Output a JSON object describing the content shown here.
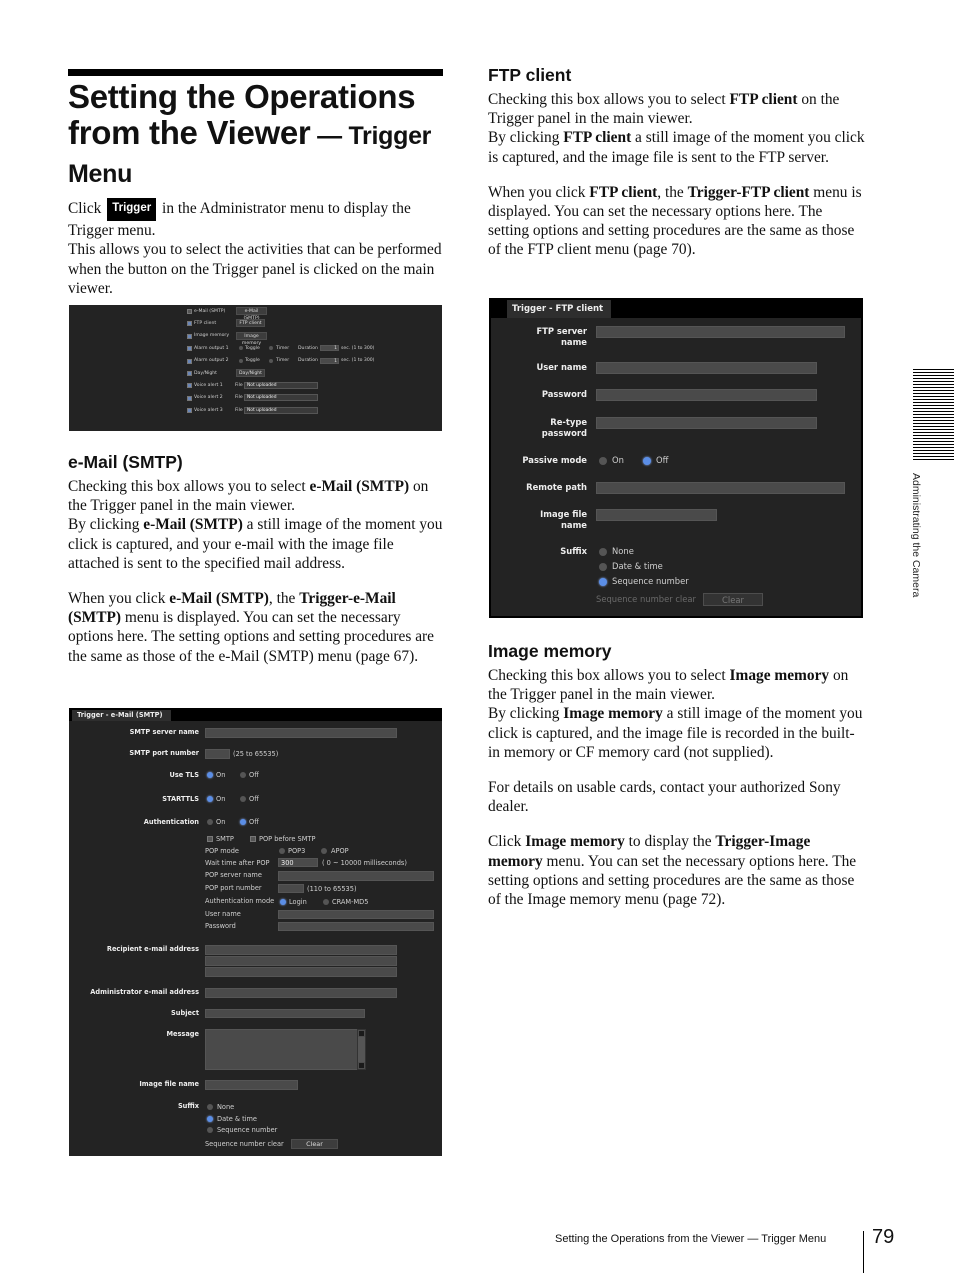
{
  "page": {
    "title_main": "Setting the Operations from the Viewer",
    "title_sub_dash": " — Trigger",
    "title_sub2": "Menu",
    "footer": "Setting the Operations from the Viewer — Trigger Menu",
    "page_number": "79",
    "side_tab": "Administrating the Camera"
  },
  "intro": {
    "click": "Click",
    "chip": "Trigger",
    "rest1": " in the Administrator menu to display the Trigger menu.",
    "para2": "This allows you to select the activities that can be performed when the button on the Trigger panel is clicked on the main viewer."
  },
  "overview_panel": {
    "rows": [
      {
        "label": "e-Mail (SMTP)",
        "checked": false,
        "button": "e-Mail (SMTP)"
      },
      {
        "label": "FTP client",
        "checked": true,
        "button": "FTP client"
      },
      {
        "label": "Image memory",
        "checked": true,
        "button": "Image memory"
      },
      {
        "label": "Alarm output 1",
        "checked": true,
        "opt1": "Toggle",
        "opt2": "Timer",
        "duration_label": "Duration",
        "duration_value": "1",
        "range": "sec. (1 to 300)"
      },
      {
        "label": "Alarm output 2",
        "checked": true,
        "opt1": "Toggle",
        "opt2": "Timer",
        "duration_label": "Duration",
        "duration_value": "1",
        "range": "sec. (1 to 300)"
      },
      {
        "label": "Day/Night",
        "checked": true,
        "button": "Day/Night"
      },
      {
        "label": "Voice alert 1",
        "checked": true,
        "file_label": "File",
        "file_value": "Not uploaded"
      },
      {
        "label": "Voice alert 2",
        "checked": true,
        "file_label": "File",
        "file_value": "Not uploaded"
      },
      {
        "label": "Voice alert 3",
        "checked": true,
        "file_label": "File",
        "file_value": "Not uploaded"
      }
    ]
  },
  "email": {
    "heading": "e-Mail (SMTP)",
    "p1_a": "Checking this box allows you to select ",
    "p1_b": "e-Mail (SMTP)",
    "p1_c": " on the Trigger panel in the main viewer.",
    "p2_a": "By clicking ",
    "p2_b": "e-Mail (SMTP)",
    "p2_c": " a still image of the moment you click is captured, and your e-mail with the image file attached is sent to the specified mail address.",
    "p3_a": "When you click ",
    "p3_b": "e-Mail (SMTP)",
    "p3_c": ", the ",
    "p3_d": "Trigger-e-Mail (SMTP)",
    "p3_e": " menu is displayed. You can set the necessary options here. The setting options and setting procedures are the same as those of the e-Mail (SMTP) menu (page 67)."
  },
  "email_panel": {
    "tab": "Trigger - e-Mail (SMTP)",
    "smtp_server_name": "SMTP server name",
    "smtp_port_number": "SMTP port number",
    "smtp_port_range": "(25 to 65535)",
    "use_tls": "Use TLS",
    "starttls": "STARTTLS",
    "authentication": "Authentication",
    "on": "On",
    "off": "Off",
    "use_tls_value": "On",
    "starttls_value": "On",
    "authentication_value": "Off",
    "smtp_chk": "SMTP",
    "pop_before_smtp_chk": "POP before SMTP",
    "pop_mode": "POP mode",
    "pop3": "POP3",
    "apop": "APOP",
    "wait_time": "Wait time after POP",
    "wait_time_value": "300",
    "wait_time_range": "( 0 ~ 10000 milliseconds)",
    "pop_server_name": "POP server name",
    "pop_port_number": "POP port number",
    "pop_port_range": "(110 to 65535)",
    "auth_mode": "Authentication mode",
    "login": "Login",
    "cram": "CRAM-MD5",
    "auth_mode_value": "Login",
    "user_name": "User name",
    "password": "Password",
    "recipient": "Recipient e-mail address",
    "administrator": "Administrator e-mail address",
    "subject": "Subject",
    "message": "Message",
    "image_file_name": "Image file name",
    "suffix": "Suffix",
    "suffix_none": "None",
    "suffix_date": "Date & time",
    "suffix_seq": "Sequence number",
    "suffix_value": "Date & time",
    "seq_clear": "Sequence number clear",
    "clear": "Clear"
  },
  "ftp": {
    "heading": "FTP client",
    "p1_a": "Checking this box allows you to select ",
    "p1_b": "FTP client",
    "p1_c": " on the Trigger panel in the main viewer.",
    "p2_a": "By clicking ",
    "p2_b": "FTP client",
    "p2_c": " a still image of the moment you click is captured, and the image file is sent to the FTP server.",
    "p3_a": "When you click ",
    "p3_b": "FTP client",
    "p3_c": ", the ",
    "p3_d": "Trigger-FTP client",
    "p3_e": " menu is displayed. You can set the necessary options here. The setting options and setting procedures are the same as those of the FTP client menu (page 70)."
  },
  "ftp_panel": {
    "tab": "Trigger - FTP client",
    "ftp_server_name_1": "FTP server",
    "ftp_server_name_2": "name",
    "user_name": "User name",
    "password": "Password",
    "retype_1": "Re-type",
    "retype_2": "password",
    "passive_mode": "Passive mode",
    "on": "On",
    "off": "Off",
    "passive_mode_value": "Off",
    "remote_path": "Remote path",
    "image_file_1": "Image file",
    "image_file_2": "name",
    "suffix": "Suffix",
    "suffix_none": "None",
    "suffix_date": "Date & time",
    "suffix_seq": "Sequence number",
    "suffix_value": "Sequence number",
    "seq_clear": "Sequence number clear",
    "clear": "Clear"
  },
  "image_memory": {
    "heading": "Image memory",
    "p1_a": "Checking this box allows you to select ",
    "p1_b": "Image memory",
    "p1_c": " on the Trigger panel in the main viewer.",
    "p2_a": "By clicking ",
    "p2_b": "Image memory",
    "p2_c": " a still image of the moment you click is captured, and the image file is recorded in the built-in memory or CF memory card (not supplied).",
    "p3": "For details on usable cards, contact your authorized Sony dealer.",
    "p4_a": "Click ",
    "p4_b": "Image memory",
    "p4_c": " to display the ",
    "p4_d": "Trigger-Image memory",
    "p4_e": " menu. You can set the necessary options here. The setting options and setting procedures are the same as those of the Image memory menu (page 72)."
  },
  "colors": {
    "panel_bg": "#232323",
    "field_bg": "#4a4a4a",
    "radio_selected": "#5b8ee6"
  }
}
